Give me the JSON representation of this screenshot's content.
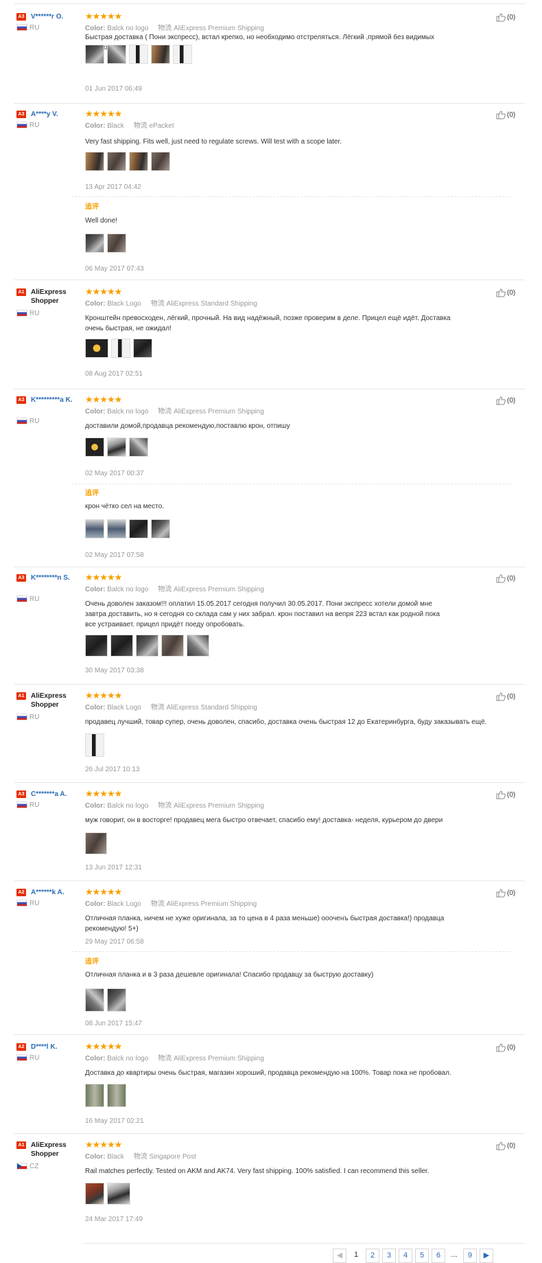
{
  "reviews": [
    {
      "badge": "A3",
      "user": "V******r O.",
      "country": "RU",
      "flag": "ru",
      "stars": "★★★★★",
      "color_label": "Color:",
      "color_value": "Balck no logo",
      "ship_label": "物流",
      "ship_value": "AliExpress Premium Shipping",
      "text": "Быстрая доставка ( Пони экспресс), встал крепко, но необходимо отстреляться. Лёгкий ,прямой без видимых изъянов.",
      "date": "01 Jun 2017 06:49",
      "useful": "(0)",
      "append_label": "",
      "append_text": "",
      "append_date": ""
    },
    {
      "badge": "A3",
      "user": "A****y V.",
      "country": "RU",
      "flag": "ru",
      "stars": "★★★★★",
      "color_label": "Color:",
      "color_value": "Black",
      "ship_label": "物流",
      "ship_value": "ePacket",
      "text": "Very fast shipping. Fits well, just need to regulate screws. Will test with a scope later.",
      "date": "13 Apr 2017 04:42",
      "useful": "(0)",
      "append_label": "追评",
      "append_text": "Well done!",
      "append_date": "06 May 2017 07:43"
    },
    {
      "badge": "A1",
      "user": "AliExpress Shopper",
      "country": "RU",
      "flag": "ru",
      "stars": "★★★★★",
      "color_label": "Color:",
      "color_value": "Black Logo",
      "ship_label": "物流",
      "ship_value": "AliExpress Standard Shipping",
      "text": "Кронштейн превосходен, лёгкий, прочный. На вид надёжный, позже проверим в деле. Прицел ещё идёт. Доставка очень быстрая, не ожидал!",
      "date": "08 Aug 2017 02:51",
      "useful": "(0)",
      "append_label": "",
      "append_text": "",
      "append_date": ""
    },
    {
      "badge": "A3",
      "user": "K*********a K.",
      "country": "RU",
      "flag": "ru",
      "stars": "★★★★★",
      "color_label": "Color:",
      "color_value": "Balck no logo",
      "ship_label": "物流",
      "ship_value": "AliExpress Premium Shipping",
      "text": "доставили домой,продавца рекомендую,поставлю крон, отпишу",
      "date": "02 May 2017 00:37",
      "useful": "(0)",
      "append_label": "追评",
      "append_text": "крон чётко сел на место.",
      "append_date": "02 May 2017 07:58"
    },
    {
      "badge": "A3",
      "user": "K********n S.",
      "country": "RU",
      "flag": "ru",
      "stars": "★★★★★",
      "color_label": "Color:",
      "color_value": "Balck no logo",
      "ship_label": "物流",
      "ship_value": "AliExpress Premium Shipping",
      "text": "Очень доволен заказом!!! оплатил 15.05.2017 сегодня получил 30.05.2017. Пони экспресс хотели домой мне завтра доставить, но я сегодня со склада сам у них забрал. крон поставил на вепря 223 встал как родной пока все устраивает. прицел придёт поеду опробовать.",
      "date": "30 May 2017 03:38",
      "useful": "(0)",
      "append_label": "",
      "append_text": "",
      "append_date": ""
    },
    {
      "badge": "A1",
      "user": "AliExpress Shopper",
      "country": "RU",
      "flag": "ru",
      "stars": "★★★★★",
      "color_label": "Color:",
      "color_value": "Black Logo",
      "ship_label": "物流",
      "ship_value": "AliExpress Standard Shipping",
      "text": "продавец лучший, товар супер, очень доволен, спасибо, доставка очень быстрая 12 до Екатеринбурга, буду заказывать ещё.",
      "date": "26 Jul 2017 10:13",
      "useful": "(0)",
      "append_label": "",
      "append_text": "",
      "append_date": ""
    },
    {
      "badge": "A3",
      "user": "C*******a A.",
      "country": "RU",
      "flag": "ru",
      "stars": "★★★★★",
      "color_label": "Color:",
      "color_value": "Balck no logo",
      "ship_label": "物流",
      "ship_value": "AliExpress Premium Shipping",
      "text": "муж говорит, он в восторге! продавец мега быстро отвечает, спасибо ему! доставка- неделя, курьером до двери",
      "date": "13 Jun 2017 12:31",
      "useful": "(0)",
      "append_label": "",
      "append_text": "",
      "append_date": ""
    },
    {
      "badge": "A2",
      "user": "A******k A.",
      "country": "RU",
      "flag": "ru",
      "stars": "★★★★★",
      "color_label": "Color:",
      "color_value": "Black Logo",
      "ship_label": "物流",
      "ship_value": "AliExpress Premium Shipping",
      "text": "Отличная планка, ничем не хуже оригинала, за то цена в 4 раза меньше) оооченъ быстрая доставка!) продавца рекомендую! 5+)",
      "date": "29 May 2017 06:58",
      "useful": "(0)",
      "append_label": "追评",
      "append_text": "Отличная планка и в 3 раза дешевле оригинала! Спасибо продавцу за быструю доставку)",
      "append_date": "08 Jun 2017 15:47"
    },
    {
      "badge": "A2",
      "user": "D****l K.",
      "country": "RU",
      "flag": "ru",
      "stars": "★★★★★",
      "color_label": "Color:",
      "color_value": "Balck no logo",
      "ship_label": "物流",
      "ship_value": "AliExpress Premium Shipping",
      "text": "Доставка до квартиры очень быстрая, магазин хороший, продавца рекомендую на 100%. Товар пока не пробовал.",
      "date": "16 May 2017 02:21",
      "useful": "(0)",
      "append_label": "",
      "append_text": "",
      "append_date": ""
    },
    {
      "badge": "A1",
      "user": "AliExpress Shopper",
      "country": "CZ",
      "flag": "cz",
      "stars": "★★★★★",
      "color_label": "Color:",
      "color_value": "Black",
      "ship_label": "物流",
      "ship_value": "Singapore Post",
      "text": "Rail matches perfectly. Tested on AKM and AK74. Very fast shipping. 100% satisfied. I can recommend this seller.",
      "date": "24 Mar 2017 17:49",
      "useful": "(0)",
      "append_label": "",
      "append_text": "",
      "append_date": ""
    }
  ],
  "pagination": {
    "prev": "◀",
    "pages": [
      "1",
      "2",
      "3",
      "4",
      "5",
      "6"
    ],
    "ellipsis": "...",
    "last": "9",
    "next": "▶"
  },
  "colors": {
    "star": "#f7a000",
    "link": "#2a6bb5",
    "badge": "#e62e04",
    "append": "#f7a000"
  }
}
